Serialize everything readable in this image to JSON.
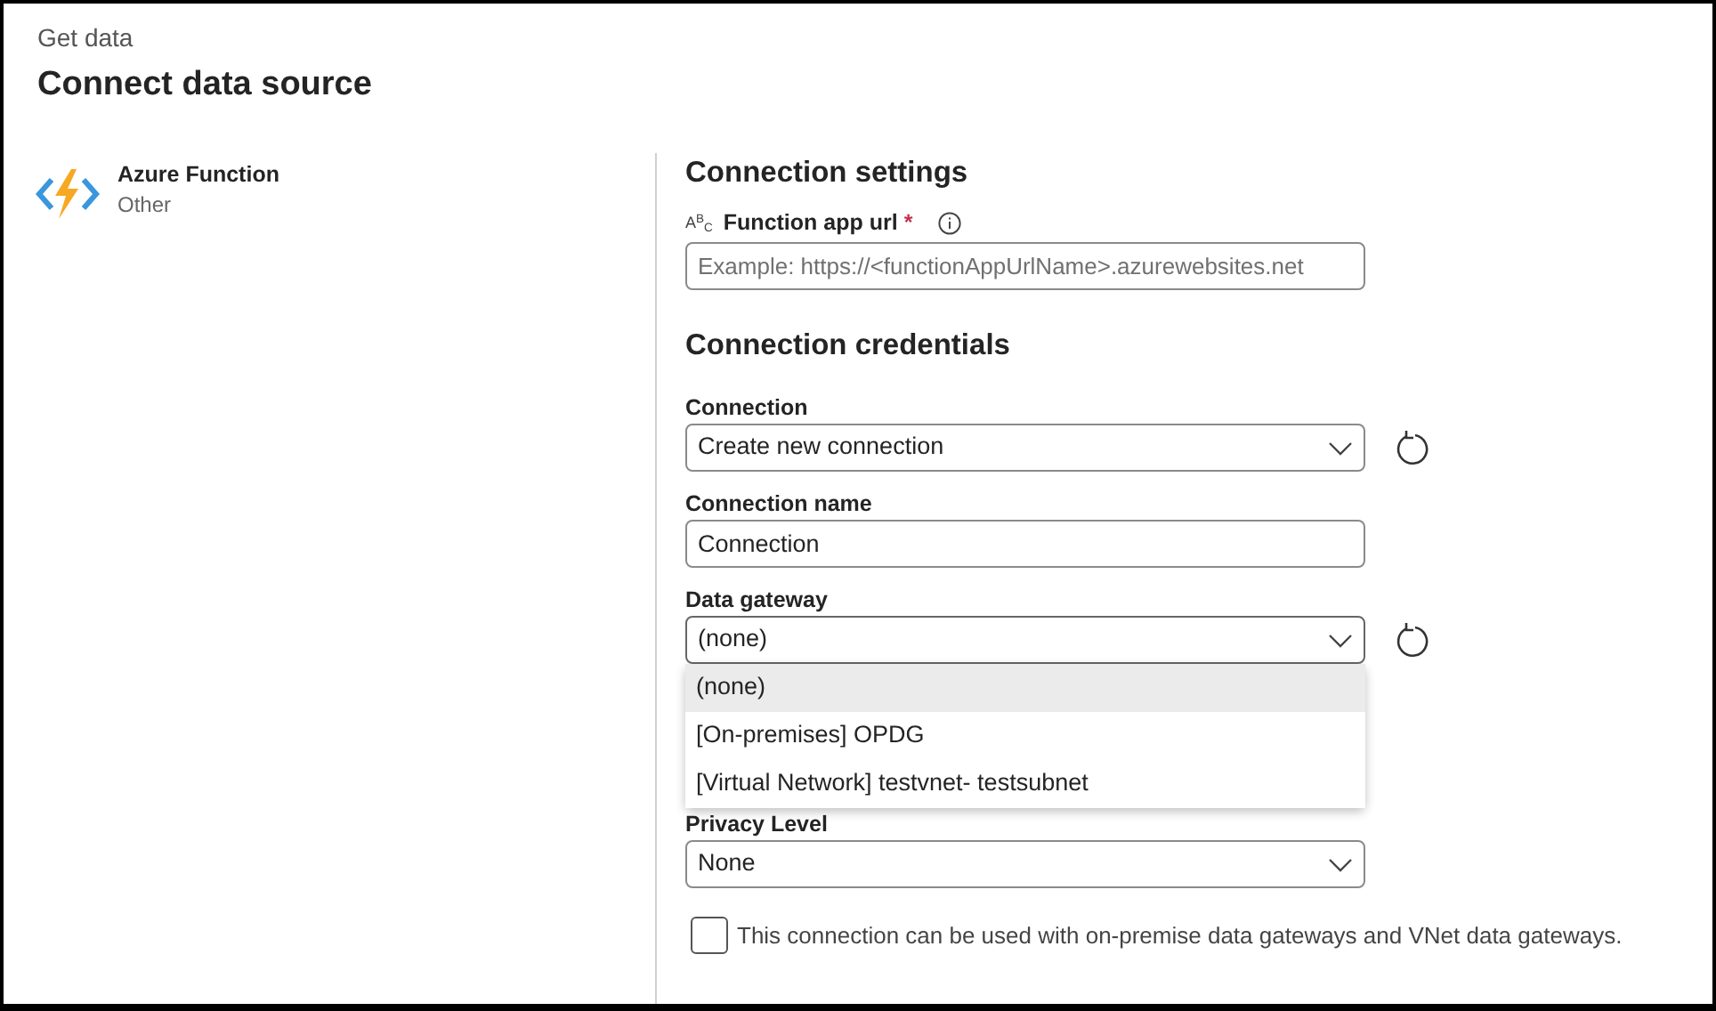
{
  "header": {
    "breadcrumb": "Get data",
    "title": "Connect data source"
  },
  "source": {
    "name": "Azure Function",
    "category": "Other"
  },
  "settings": {
    "heading": "Connection settings",
    "fields": [
      {
        "type_icon": [
          "A",
          "B",
          "C"
        ],
        "label": "Function app url",
        "required_mark": "*",
        "placeholder": "Example: https://<functionAppUrlName>.azurewebsites.net"
      }
    ]
  },
  "credentials": {
    "heading": "Connection credentials",
    "fields": [
      {
        "kind": "select",
        "label": "Connection",
        "value": "Create new connection",
        "refresh": true
      },
      {
        "kind": "text",
        "label": "Connection name",
        "value": "Connection"
      },
      {
        "kind": "select",
        "label": "Data gateway",
        "value": "(none)",
        "refresh": true,
        "expanded": true,
        "options": [
          {
            "label": "(none)",
            "selected": true
          },
          {
            "label": "[On-premises] OPDG",
            "selected": false
          },
          {
            "label": "[Virtual Network] testvnet- testsubnet",
            "selected": false
          }
        ]
      },
      {
        "kind": "select",
        "label": "Privacy Level",
        "value": "None",
        "refresh": false
      }
    ]
  },
  "gateway_checkbox": {
    "label": "This connection can be used with on-premise data gateways and VNet data gateways.",
    "checked": false
  }
}
